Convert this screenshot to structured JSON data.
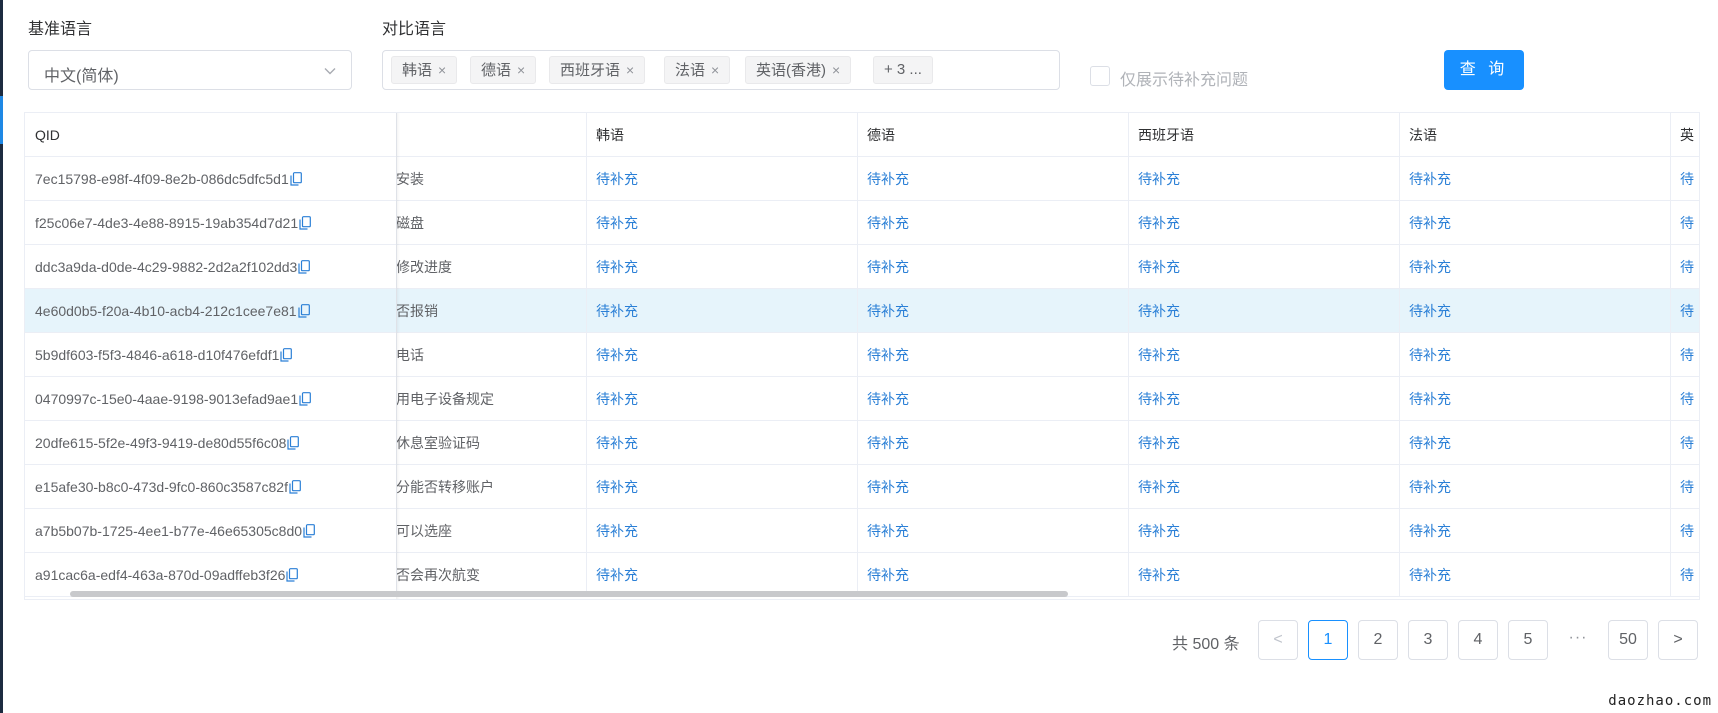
{
  "filters": {
    "base_label": "基准语言",
    "base_value": "中文(简体)",
    "compare_label": "对比语言",
    "compare_tags": [
      "韩语",
      "德语",
      "西班牙语",
      "法语",
      "英语(香港)"
    ],
    "more_tag": "+ 3 ...",
    "only_pending_label": "仅展示待补充问题",
    "only_pending_checked": false,
    "query_button": "查 询"
  },
  "table": {
    "columns": [
      "QID",
      "",
      "韩语",
      "德语",
      "西班牙语",
      "法语",
      "英"
    ],
    "rows": [
      {
        "qid": "7ec15798-e98f-4f09-8e2b-086dc5dfc5d1",
        "cn": "安装",
        "cells": [
          "待补充",
          "待补充",
          "待补充",
          "待补充",
          "待"
        ]
      },
      {
        "qid": "f25c06e7-4de3-4e88-8915-19ab354d7d21",
        "cn": "磁盘",
        "cells": [
          "待补充",
          "待补充",
          "待补充",
          "待补充",
          "待"
        ]
      },
      {
        "qid": "ddc3a9da-d0de-4c29-9882-2d2a2f102dd3",
        "cn": "修改进度",
        "cells": [
          "待补充",
          "待补充",
          "待补充",
          "待补充",
          "待"
        ]
      },
      {
        "qid": "4e60d0b5-f20a-4b10-acb4-212c1cee7e81",
        "cn": "否报销",
        "cells": [
          "待补充",
          "待补充",
          "待补充",
          "待补充",
          "待"
        ]
      },
      {
        "qid": "5b9df603-f5f3-4846-a618-d10f476efdf1",
        "cn": "电话",
        "cells": [
          "待补充",
          "待补充",
          "待补充",
          "待补充",
          "待"
        ]
      },
      {
        "qid": "0470997c-15e0-4aae-9198-9013efad9ae1",
        "cn": "用电子设备规定",
        "cells": [
          "待补充",
          "待补充",
          "待补充",
          "待补充",
          "待"
        ]
      },
      {
        "qid": "20dfe615-5f2e-49f3-9419-de80d55f6c08",
        "cn": "休息室验证码",
        "cells": [
          "待补充",
          "待补充",
          "待补充",
          "待补充",
          "待"
        ]
      },
      {
        "qid": "e15afe30-b8c0-473d-9fc0-860c3587c82f",
        "cn": "分能否转移账户",
        "cells": [
          "待补充",
          "待补充",
          "待补充",
          "待补充",
          "待"
        ]
      },
      {
        "qid": "a7b5b07b-1725-4ee1-b77e-46e65305c8d0",
        "cn": "可以选座",
        "cells": [
          "待补充",
          "待补充",
          "待补充",
          "待补充",
          "待"
        ]
      },
      {
        "qid": "a91cac6a-edf4-463a-870d-09adffeb3f26",
        "cn": "否会再次航变",
        "cells": [
          "待补充",
          "待补充",
          "待补充",
          "待补充",
          "待"
        ]
      }
    ],
    "highlighted_row": 3
  },
  "pagination": {
    "total": "共 500 条",
    "prev": "<",
    "pages": [
      "1",
      "2",
      "3",
      "4",
      "5"
    ],
    "dots": "···",
    "last": "50",
    "next": ">",
    "current": "1"
  },
  "watermark": "daozhao.com",
  "colors": {
    "primary": "#1890ff",
    "link": "#2a7fd6",
    "row_highlight": "#e6f4fb",
    "sidebar": "#1c2b40"
  }
}
